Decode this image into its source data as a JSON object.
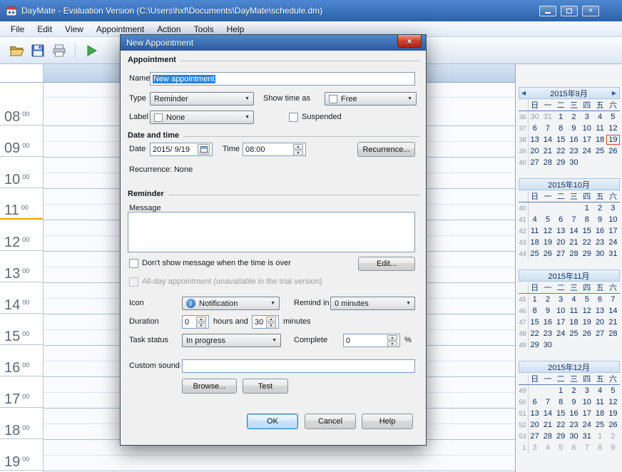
{
  "window": {
    "title": "DayMate - Evaluation Version (C:\\Users\\hxf\\Documents\\DayMate\\schedule.dm)",
    "menu": [
      "File",
      "Edit",
      "View",
      "Appointment",
      "Action",
      "Tools",
      "Help"
    ]
  },
  "toolbar": {
    "icons": [
      "open-file",
      "save",
      "print",
      "run"
    ]
  },
  "schedule": {
    "hours": [
      "08",
      "09",
      "10",
      "11",
      "12",
      "13",
      "14",
      "15",
      "16",
      "17",
      "18",
      "19"
    ],
    "minutes": "00",
    "current_hour": "11"
  },
  "icons": {
    "dropdown": "▼",
    "up": "▲",
    "down": "▼",
    "close": "×",
    "minimize": "–",
    "info": "i"
  },
  "colors": {
    "titlebar_blue": "#2c62a8",
    "selection_blue": "#2e81d8",
    "today_red": "#d84040",
    "now_marker_orange": "#ff9d00"
  },
  "dialog": {
    "title": "New Appointment",
    "sections": {
      "appointment": "Appointment",
      "datetime": "Date and time",
      "reminder": "Reminder"
    },
    "fields": {
      "name_label": "Name",
      "name_value": "New appointment",
      "type_label": "Type",
      "type_value": "Reminder",
      "show_time_as_label": "Show time as",
      "show_time_as_value": "Free",
      "label_label": "Label",
      "label_value": "None",
      "suspended_label": "Suspended",
      "date_label": "Date",
      "date_value": "2015/ 9/19",
      "time_label": "Time",
      "time_value": "08:00",
      "recurrence_button": "Recurrence...",
      "recurrence_status": "Recurrence: None",
      "message_label": "Message",
      "dont_show_label": "Don't show message when the time is over",
      "edit_button": "Edit...",
      "all_day_label": "All-day appointment (unavailable in the trial version)",
      "icon_label": "Icon",
      "icon_value": "Notification",
      "remind_in_label": "Remind in",
      "remind_in_value": "0 minutes",
      "duration_label": "Duration",
      "duration_hours": "0",
      "hours_and_label": "hours and",
      "duration_minutes": "30",
      "minutes_label": "minutes",
      "task_status_label": "Task status",
      "task_status_value": "In progress",
      "complete_label": "Complete",
      "complete_value": "0",
      "percent_label": "%",
      "custom_sound_label": "Custom sound",
      "browse_button": "Browse...",
      "test_button": "Test",
      "ok_button": "OK",
      "cancel_button": "Cancel",
      "help_button": "Help"
    }
  },
  "calendar": {
    "prev_arrow": "◀",
    "next_arrow": "▶",
    "day_headers": [
      "日",
      "一",
      "二",
      "三",
      "四",
      "五",
      "六"
    ],
    "months": [
      {
        "title": "2015年9月",
        "nav": true,
        "weeks": [
          {
            "w": "36",
            "days": [
              "30",
              "31",
              "1",
              "2",
              "3",
              "4",
              "5"
            ],
            "muted": [
              0,
              1
            ],
            "today": -1
          },
          {
            "w": "37",
            "days": [
              "6",
              "7",
              "8",
              "9",
              "10",
              "11",
              "12"
            ],
            "muted": [],
            "today": -1
          },
          {
            "w": "38",
            "days": [
              "13",
              "14",
              "15",
              "16",
              "17",
              "18",
              "19"
            ],
            "muted": [],
            "today": 6
          },
          {
            "w": "39",
            "days": [
              "20",
              "21",
              "22",
              "23",
              "24",
              "25",
              "26"
            ],
            "muted": [],
            "today": -1
          },
          {
            "w": "40",
            "days": [
              "27",
              "28",
              "29",
              "30",
              "",
              "",
              ""
            ],
            "muted": [],
            "today": -1
          }
        ]
      },
      {
        "title": "2015年10月",
        "nav": false,
        "weeks": [
          {
            "w": "40",
            "days": [
              "",
              "",
              "",
              "",
              "1",
              "2",
              "3"
            ],
            "muted": [],
            "today": -1
          },
          {
            "w": "41",
            "days": [
              "4",
              "5",
              "6",
              "7",
              "8",
              "9",
              "10"
            ],
            "muted": [],
            "today": -1
          },
          {
            "w": "42",
            "days": [
              "11",
              "12",
              "13",
              "14",
              "15",
              "16",
              "17"
            ],
            "muted": [],
            "today": -1
          },
          {
            "w": "43",
            "days": [
              "18",
              "19",
              "20",
              "21",
              "22",
              "23",
              "24"
            ],
            "muted": [],
            "today": -1
          },
          {
            "w": "44",
            "days": [
              "25",
              "26",
              "27",
              "28",
              "29",
              "30",
              "31"
            ],
            "muted": [],
            "today": -1
          }
        ]
      },
      {
        "title": "2015年11月",
        "nav": false,
        "weeks": [
          {
            "w": "45",
            "days": [
              "1",
              "2",
              "3",
              "4",
              "5",
              "6",
              "7"
            ],
            "muted": [],
            "today": -1
          },
          {
            "w": "46",
            "days": [
              "8",
              "9",
              "10",
              "11",
              "12",
              "13",
              "14"
            ],
            "muted": [],
            "today": -1
          },
          {
            "w": "47",
            "days": [
              "15",
              "16",
              "17",
              "18",
              "19",
              "20",
              "21"
            ],
            "muted": [],
            "today": -1
          },
          {
            "w": "48",
            "days": [
              "22",
              "23",
              "24",
              "25",
              "26",
              "27",
              "28"
            ],
            "muted": [],
            "today": -1
          },
          {
            "w": "49",
            "days": [
              "29",
              "30",
              "",
              "",
              "",
              "",
              ""
            ],
            "muted": [],
            "today": -1
          }
        ]
      },
      {
        "title": "2015年12月",
        "nav": false,
        "weeks": [
          {
            "w": "49",
            "days": [
              "",
              "",
              "1",
              "2",
              "3",
              "4",
              "5"
            ],
            "muted": [],
            "today": -1
          },
          {
            "w": "50",
            "days": [
              "6",
              "7",
              "8",
              "9",
              "10",
              "11",
              "12"
            ],
            "muted": [],
            "today": -1
          },
          {
            "w": "51",
            "days": [
              "13",
              "14",
              "15",
              "16",
              "17",
              "18",
              "19"
            ],
            "muted": [],
            "today": -1
          },
          {
            "w": "52",
            "days": [
              "20",
              "21",
              "22",
              "23",
              "24",
              "25",
              "26"
            ],
            "muted": [],
            "today": -1
          },
          {
            "w": "53",
            "days": [
              "27",
              "28",
              "29",
              "30",
              "31",
              "1",
              "2"
            ],
            "muted": [
              5,
              6
            ],
            "today": -1
          },
          {
            "w": "1",
            "days": [
              "3",
              "4",
              "5",
              "6",
              "7",
              "8",
              "9"
            ],
            "muted": [
              0,
              1,
              2,
              3,
              4,
              5,
              6
            ],
            "today": -1
          }
        ]
      }
    ]
  }
}
